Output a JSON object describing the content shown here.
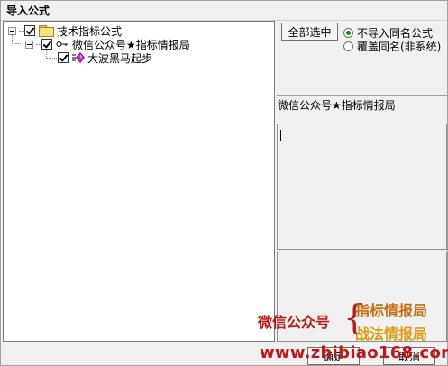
{
  "window": {
    "title": "导入公式"
  },
  "tree": {
    "root": {
      "label": "技术指标公式",
      "checked": true,
      "expanded": true
    },
    "child": {
      "label": "微信公众号★指标情报局",
      "checked": true,
      "expanded": true
    },
    "leaf": {
      "label": "大波黑马起步",
      "checked": true
    }
  },
  "options": {
    "select_all_label": "全部选中",
    "radio_no_import": "不导入同名公式",
    "radio_overwrite": "覆盖同名(非系统)",
    "selected": "radio_no_import"
  },
  "details": {
    "name_text": "微信公众号★指标情报局",
    "edit_text": ""
  },
  "buttons": {
    "ok": "确定",
    "cancel": "取消"
  },
  "watermark": {
    "left": "微信公众号",
    "brace": "{",
    "right_top": "指标情报局",
    "right_bottom": "战法情报局",
    "url": "www.zhibiao168.com"
  },
  "colors": {
    "watermark_red": "#c01818",
    "watermark_orange": "#c86c0a",
    "watermark_gold": "#d8a010",
    "radio_selected": "#1c8a1c"
  }
}
